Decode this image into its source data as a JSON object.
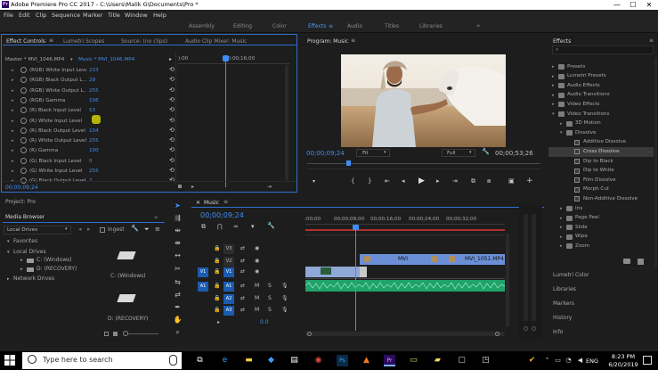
{
  "colors": {
    "accent": "#3e8ef7",
    "panel_bg": "#1d1d1d",
    "timeline_playhead": "#3e8ef7",
    "clip_video": "#6b8fd6",
    "clip_audio": "#1fa36a"
  },
  "titlebar": {
    "title": "Adobe Premiere Pro CC 2017 - C:\\Users\\Malik G\\Documents\\Pro *",
    "minimize": "—",
    "maximize": "☐",
    "close": "✕"
  },
  "menu": [
    "File",
    "Edit",
    "Clip",
    "Sequence",
    "Marker",
    "Title",
    "Window",
    "Help"
  ],
  "workspaces": [
    "Assembly",
    "Editing",
    "Color",
    "Effects",
    "Audio",
    "Titles",
    "Libraries"
  ],
  "workspace_active": "Effects",
  "effect_controls": {
    "tabs": [
      "Effect Controls",
      "Lumetri Scopes",
      "Source: (no clips)",
      "Audio Clip Mixer: Music"
    ],
    "master": "Master * MVI_1046.MP4",
    "clip": "Music * MVI_1046.MP4",
    "ruler_left": "):00",
    "ruler_time": "00;00;16;00",
    "timecode": "00;00;09;24",
    "rows": [
      {
        "label": "(RGB) White Input Level",
        "value": "233"
      },
      {
        "label": "(RGB) Black Output L...",
        "value": "29"
      },
      {
        "label": "(RGB) White Output L...",
        "value": "255"
      },
      {
        "label": "(RGB) Gamma",
        "value": "106"
      },
      {
        "label": "(R) Black Input Level",
        "value": "53"
      },
      {
        "label": "(R) White Input Level",
        "value": ""
      },
      {
        "label": "(R) Black Output Level",
        "value": "104"
      },
      {
        "label": "(R) White Output Level",
        "value": "255"
      },
      {
        "label": "(R) Gamma",
        "value": "100"
      },
      {
        "label": "(G) Black Input Level",
        "value": "0"
      },
      {
        "label": "(G) White Input Level",
        "value": "255"
      },
      {
        "label": "(G) Black Output Level",
        "value": "2"
      }
    ]
  },
  "program": {
    "title": "Program: Music",
    "timecode": "00;00;09;24",
    "fit": "Fit",
    "quality": "Full",
    "duration": "00;00;53;26"
  },
  "effects_panel": {
    "title": "Effects",
    "items": [
      {
        "label": "Presets",
        "type": "folder",
        "depth": 0,
        "open": false
      },
      {
        "label": "Lumetri Presets",
        "type": "folder",
        "depth": 0,
        "open": false
      },
      {
        "label": "Audio Effects",
        "type": "folder",
        "depth": 0,
        "open": false
      },
      {
        "label": "Audio Transitions",
        "type": "folder",
        "depth": 0,
        "open": false
      },
      {
        "label": "Video Effects",
        "type": "folder",
        "depth": 0,
        "open": false
      },
      {
        "label": "Video Transitions",
        "type": "folder",
        "depth": 0,
        "open": true
      },
      {
        "label": "3D Motion",
        "type": "folder",
        "depth": 1,
        "open": false
      },
      {
        "label": "Dissolve",
        "type": "folder",
        "depth": 1,
        "open": true
      },
      {
        "label": "Additive Dissolve",
        "type": "fx",
        "depth": 2
      },
      {
        "label": "Cross Dissolve",
        "type": "fx",
        "depth": 2,
        "selected": true
      },
      {
        "label": "Dip to Black",
        "type": "fx",
        "depth": 2
      },
      {
        "label": "Dip to White",
        "type": "fx",
        "depth": 2
      },
      {
        "label": "Film Dissolve",
        "type": "fx",
        "depth": 2
      },
      {
        "label": "Morph Cut",
        "type": "fx",
        "depth": 2
      },
      {
        "label": "Non-Additive Dissolve",
        "type": "fx",
        "depth": 2
      },
      {
        "label": "Iris",
        "type": "folder",
        "depth": 1,
        "open": false
      },
      {
        "label": "Page Peel",
        "type": "folder",
        "depth": 1,
        "open": false
      },
      {
        "label": "Slide",
        "type": "folder",
        "depth": 1,
        "open": false
      },
      {
        "label": "Wipe",
        "type": "folder",
        "depth": 1,
        "open": false
      },
      {
        "label": "Zoom",
        "type": "folder",
        "depth": 1,
        "open": false
      }
    ]
  },
  "right_lower": [
    "Lumetri Color",
    "Libraries",
    "Markers",
    "History",
    "Info"
  ],
  "project": {
    "title": "Project: Pro",
    "tab": "Media Browser",
    "location": "Local Drives",
    "ingest": "Ingest",
    "favorites": "Favorites",
    "local_drives": "Local Drives",
    "drives": [
      "C: (Windows)",
      "D: (RECOVERY)"
    ],
    "network": "Network Drives",
    "icon_labels": [
      "C: (Windows)",
      "D: (RECOVERY)"
    ]
  },
  "timeline": {
    "tab": "Music",
    "timecode": "00;00;09;24",
    "ruler": [
      ":00;00",
      "00;00;08;00",
      "00;00;16;00",
      "00;00;24;00",
      "00;00;32;00"
    ],
    "tracks": [
      {
        "name": "V3",
        "src": ""
      },
      {
        "name": "V2",
        "src": ""
      },
      {
        "name": "V1",
        "src": "V1"
      },
      {
        "name": "A1",
        "src": "A1"
      },
      {
        "name": "A2",
        "src": ""
      },
      {
        "name": "A3",
        "src": ""
      }
    ],
    "m": "M",
    "s": "S",
    "clips": [
      "MVI",
      "MVI_1051.MP4"
    ],
    "vol": "0.0"
  },
  "taskbar": {
    "search": "Type here to search",
    "time": "8:23 PM",
    "date": "6/20/2019",
    "lang": "ENG"
  }
}
